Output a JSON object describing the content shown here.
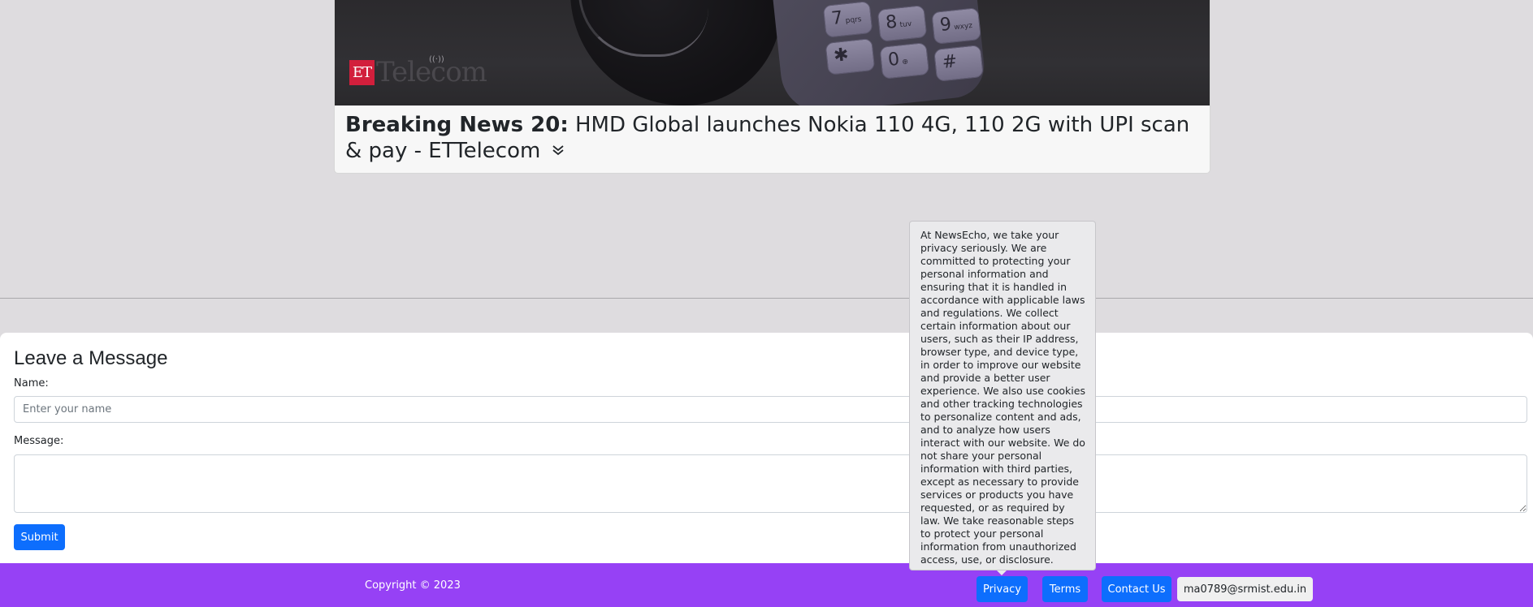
{
  "news": {
    "image_logo_et": "ET",
    "image_logo_text": "Telecom",
    "headline_lead": "Breaking News 20:",
    "headline_text": " HMD Global launches Nokia 110 4G, 110 2G with UPI scan & pay - ETTelecom",
    "expand_icon": "chevron-double-down-icon"
  },
  "form": {
    "title": "Leave a Message",
    "name_label": "Name:",
    "name_placeholder": "Enter your name",
    "name_value": "",
    "message_label": "Message:",
    "message_value": "",
    "submit_label": "Submit"
  },
  "footer": {
    "copyright": "Copyright © 2023",
    "privacy_label": "Privacy",
    "terms_label": "Terms",
    "contact_label": "Contact Us",
    "email": "ma0789@srmist.edu.in"
  },
  "privacy_tooltip": {
    "text": "At NewsEcho, we take your privacy seriously. We are committed to protecting your personal information and ensuring that it is handled in accordance with applicable laws and regulations. We collect certain information about our users, such as their IP address, browser type, and device type, in order to improve our website and provide a better user experience. We also use cookies and other tracking technologies to personalize content and ads, and to analyze how users interact with our website. We do not share your personal information with third parties, except as necessary to provide services or products you have requested, or as required by law. We take reasonable steps to protect your personal information from unauthorized access, use, or disclosure."
  },
  "colors": {
    "page_background": "#dedcdf",
    "footer_background": "#9641f5",
    "primary_button": "#0d6efd",
    "logo_red": "#d21f3c"
  }
}
